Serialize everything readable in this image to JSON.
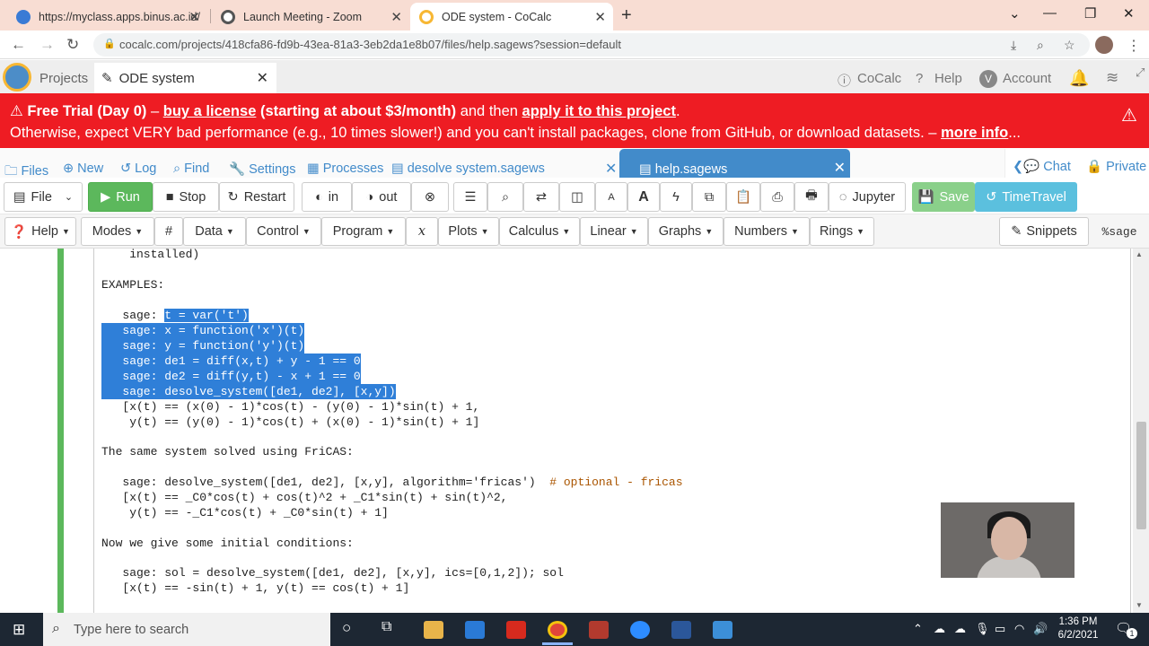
{
  "browser": {
    "tabs": [
      {
        "title": "https://myclass.apps.binus.ac.id/"
      },
      {
        "title": "Launch Meeting - Zoom"
      },
      {
        "title": "ODE system - CoCalc"
      }
    ],
    "url": "cocalc.com/projects/418cfa86-fd9b-43ea-81a3-3eb2da1e8b07/files/help.sagews?session=default"
  },
  "cocalc_header": {
    "projects": "Projects",
    "project_tab": "ODE system",
    "cocalc": "CoCalc",
    "help": "Help",
    "account": "Account",
    "account_initial": "V"
  },
  "banner": {
    "trial": "Free Trial (Day 0)",
    "dash1": " – ",
    "buy": "buy a license",
    "price": " (starting at about $3/month)",
    "then": " and then ",
    "apply": "apply it to this project",
    "period": ".",
    "line2": "Otherwise, expect VERY bad performance (e.g., 10 times slower!) and you can't install packages, clone from GitHub, or download datasets. – ",
    "more": "more info",
    "ellipsis": "..."
  },
  "filebar": {
    "files": "Files",
    "new": "New",
    "log": "Log",
    "find": "Find",
    "settings": "Settings",
    "processes": "Processes",
    "tab1": "desolve system.sagews",
    "tab2": "help.sagews",
    "chat": "Chat",
    "private": "Private"
  },
  "toolbar1": {
    "file": "File",
    "run": "Run",
    "stop": "Stop",
    "restart": "Restart",
    "in": "in",
    "out": "out",
    "jupyter": "Jupyter",
    "save": "Save",
    "timetravel": "TimeTravel"
  },
  "toolbar2": {
    "help": "Help",
    "modes": "Modes",
    "hash": "#",
    "data": "Data",
    "control": "Control",
    "program": "Program",
    "x": "x",
    "plots": "Plots",
    "calculus": "Calculus",
    "linear": "Linear",
    "graphs": "Graphs",
    "numbers": "Numbers",
    "rings": "Rings",
    "snippets": "Snippets",
    "mode": "%sage"
  },
  "editor": {
    "l_installed": "    installed)",
    "l_examples": "EXAMPLES:",
    "p_sage": "   sage: ",
    "s1": "t = var('t')",
    "s2": "   sage: x = function('x')(t)",
    "s3": "   sage: y = function('y')(t)",
    "s4": "   sage: de1 = diff(x,t) + y - 1 == 0",
    "s5": "   sage: de2 = diff(y,t) - x + 1 == 0",
    "s6": "   sage: desolve_system([de1, de2], [x,y])",
    "o1": "   [x(t) == (x(0) - 1)*cos(t) - (y(0) - 1)*sin(t) + 1,",
    "o2": "    y(t) == (y(0) - 1)*cos(t) + (x(0) - 1)*sin(t) + 1]",
    "t_fricas": "The same system solved using FriCAS:",
    "f1": "   sage: desolve_system([de1, de2], [x,y], algorithm='fricas')  ",
    "f1c": "# optional - fricas",
    "f2": "   [x(t) == _C0*cos(t) + cos(t)^2 + _C1*sin(t) + sin(t)^2,",
    "f3": "    y(t) == -_C1*cos(t) + _C0*sin(t) + 1]",
    "t_init": "Now we give some initial conditions:",
    "i1": "   sage: sol = desolve_system([de1, de2], [x,y], ics=[0,1,2]); sol",
    "i2": "   [x(t) == -sin(t) + 1, y(t) == cos(t) + 1]"
  },
  "taskbar": {
    "search": "Type here to search",
    "time": "1:36 PM",
    "date": "6/2/2021",
    "notif": "1"
  },
  "colors": {
    "banner_red": "#ee1c23",
    "cocalc_blue": "#428bca",
    "run_green": "#5cb85c",
    "selection": "#2f7fd8",
    "taskbar": "#1d2733"
  }
}
